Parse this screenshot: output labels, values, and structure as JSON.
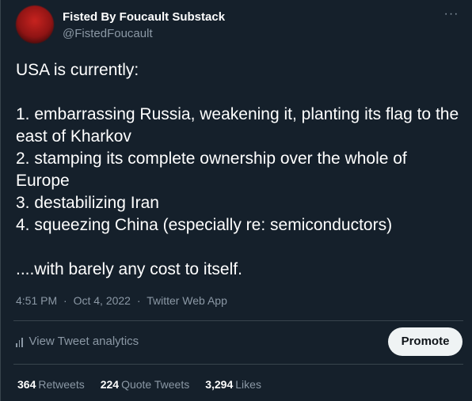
{
  "author": {
    "display_name": "Fisted By Foucault Substack",
    "handle": "@FistedFoucault",
    "avatar_color": "#c7231f"
  },
  "more_icon": "more-horizontal-icon",
  "tweet": {
    "text": "USA is currently:\n\n1. embarrassing Russia, weakening it, planting its flag to the east of Kharkov\n2. stamping its complete ownership over the whole of Europe\n3. destabilizing Iran\n4. squeezing China (especially re: semiconductors)\n\n....with barely any cost to itself."
  },
  "meta": {
    "time": "4:51 PM",
    "separator": "·",
    "date": "Oct 4, 2022",
    "source": "Twitter Web App"
  },
  "actions": {
    "analytics_label": "View Tweet analytics",
    "analytics_icon": "bar-chart-icon",
    "promote_label": "Promote"
  },
  "stats": [
    {
      "count": "364",
      "label": "Retweets"
    },
    {
      "count": "224",
      "label": "Quote Tweets"
    },
    {
      "count": "3,294",
      "label": "Likes"
    }
  ],
  "colors": {
    "background": "#15202b",
    "text_primary": "#ffffff",
    "text_secondary": "#8b98a5",
    "divider": "#38444d",
    "promote_bg": "#eff3f4"
  }
}
